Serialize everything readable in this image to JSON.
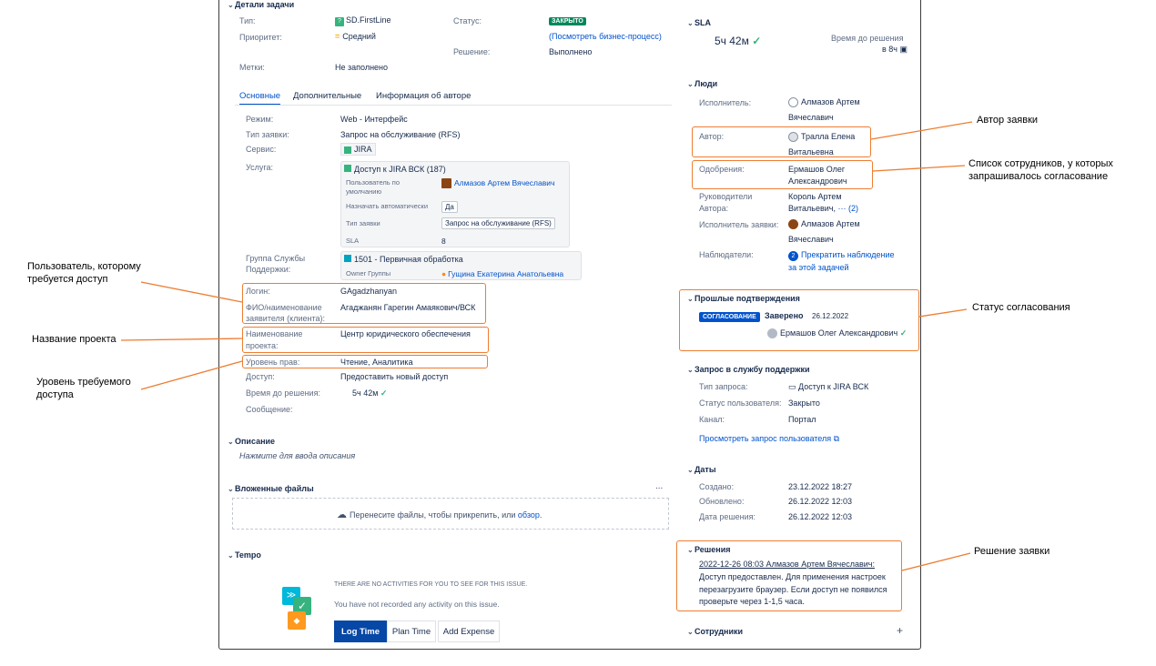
{
  "details": {
    "title": "Детали задачи",
    "type_label": "Тип:",
    "type_value": "SD.FirstLine",
    "priority_label": "Приоритет:",
    "priority_value": "Средний",
    "labels_label": "Метки:",
    "labels_value": "Не заполнено",
    "status_label": "Статус:",
    "status_value": "ЗАКРЫТО",
    "workflow_link": "(Посмотреть бизнес-процесс)",
    "resolution_label": "Решение:",
    "resolution_value": "Выполнено"
  },
  "tabs": [
    "Основные",
    "Дополнительные",
    "Информация об авторе"
  ],
  "fields": {
    "mode_label": "Режим:",
    "mode_value": "Web - Интерфейс",
    "reqtype_label": "Тип заявки:",
    "reqtype_value": "Запрос на обслуживание (RFS)",
    "service_label": "Сервис:",
    "service_value": "JIRA",
    "usluga_label": "Услуга:",
    "usluga_value": "Доступ к JIRA ВСК (187)",
    "default_user_label": "Пользователь по умолчанию",
    "default_user_value": "Алмазов Артем Вячеславич",
    "auto_assign_label": "Назначать автоматически",
    "auto_assign_value": "Да",
    "sub_reqtype_label": "Тип заявки",
    "sub_reqtype_value": "Запрос на обслуживание (RFS)",
    "sla_label": "SLA",
    "sla_value": "8",
    "group_label_1": "Группа Службы",
    "group_label_2": "Поддержки:",
    "group_value": "1501 - Первичная обработка",
    "owner_label": "Owner Группы",
    "owner_value": "Гущина Екатерина Анатольевна",
    "login_label": "Логин:",
    "login_value": "GAgadzhanyan",
    "fio_label_1": "ФИО/наименование",
    "fio_label_2": "заявителя (клиента):",
    "fio_value": "Агаджанян Гарегин Амаякович/ВСК",
    "project_label_1": "Наименование",
    "project_label_2": "проекта:",
    "project_value": "Центр юридического обеспечения",
    "rights_label": "Уровень прав:",
    "rights_value": "Чтение, Аналитика",
    "access_label": "Доступ:",
    "access_value": "Предоставить новый доступ",
    "time_label": "Время до решения:",
    "time_value": "5ч 42м",
    "message_label": "Сообщение:"
  },
  "description": {
    "title": "Описание",
    "placeholder": "Нажмите для ввода описания"
  },
  "attachments": {
    "title": "Вложенные файлы",
    "more": "...",
    "drop_text": "Перенесите файлы, чтобы прикрепить, или",
    "browse": "обзор."
  },
  "tempo": {
    "title": "Tempo",
    "no_activities": "THERE ARE NO ACTIVITIES FOR YOU TO SEE FOR THIS ISSUE.",
    "not_recorded": "You have not recorded any activity on this issue.",
    "log_time": "Log Time",
    "plan_time": "Plan Time",
    "add_expense": "Add Expense"
  },
  "sla": {
    "title": "SLA",
    "value": "5ч 42м",
    "time_label": "Время до решения",
    "time_value": "в 8ч"
  },
  "people": {
    "title": "Люди",
    "assignee_label": "Исполнитель:",
    "assignee_1": "Алмазов Артем",
    "assignee_2": "Вячеславич",
    "author_label": "Автор:",
    "author_1": "Тралла Елена",
    "author_2": "Витальевна",
    "approvals_label": "Одобрения:",
    "approvals_1": "Ермашов Олег",
    "approvals_2": "Александрович",
    "managers_label_1": "Руководители",
    "managers_label_2": "Автора:",
    "managers_1": "Король Артем",
    "managers_2": "Витальевич,",
    "managers_more": "··· (2)",
    "request_assignee_label": "Исполнитель заявки:",
    "request_assignee_1": "Алмазов Артем",
    "request_assignee_2": "Вячеславич",
    "watchers_label": "Наблюдатели:",
    "watchers_count": "2",
    "watchers_1": "Прекратить наблюдение",
    "watchers_2": "за этой задачей"
  },
  "past_approvals": {
    "title": "Прошлые подтверждения",
    "badge": "СОГЛАСОВАНИЕ",
    "status": "Заверено",
    "date": "26.12.2022",
    "approver": "Ермашов Олег Александрович"
  },
  "support_request": {
    "title": "Запрос в службу поддержки",
    "type_label": "Тип запроса:",
    "type_value": "Доступ к JIRA ВСК",
    "user_status_label": "Статус пользователя:",
    "user_status_value": "Закрыто",
    "channel_label": "Канал:",
    "channel_value": "Портал",
    "view_link": "Просмотреть запрос пользователя"
  },
  "dates": {
    "title": "Даты",
    "created_label": "Создано:",
    "created_value": "23.12.2022 18:27",
    "updated_label": "Обновлено:",
    "updated_value": "26.12.2022 12:03",
    "resolved_label": "Дата решения:",
    "resolved_value": "26.12.2022 12:03"
  },
  "resolutions": {
    "title": "Решения",
    "author_line": "2022-12-26 08:03 Алмазов Артем Вячеславич:",
    "line1": "Доступ предоставлен. Для применения настроек",
    "line2": "перезагрузите браузер. Если доступ не появился",
    "line3": "проверьте через 1-1,5 часа."
  },
  "employees": {
    "title": "Сотрудники",
    "add": "+"
  },
  "annotations": {
    "author": "Автор заявки",
    "approvers_1": "Список сотрудников, у которых",
    "approvers_2": "запрашивалось согласование",
    "status": "Статус согласования",
    "resolution": "Решение заявки",
    "user_1": "Пользователь, которому",
    "user_2": "требуется доступ",
    "project": "Название проекта",
    "level_1": "Уровень требуемого",
    "level_2": "доступа"
  },
  "colors": {
    "accent": "#0052cc",
    "annotation": "#ed7d31",
    "green": "#00875a"
  }
}
